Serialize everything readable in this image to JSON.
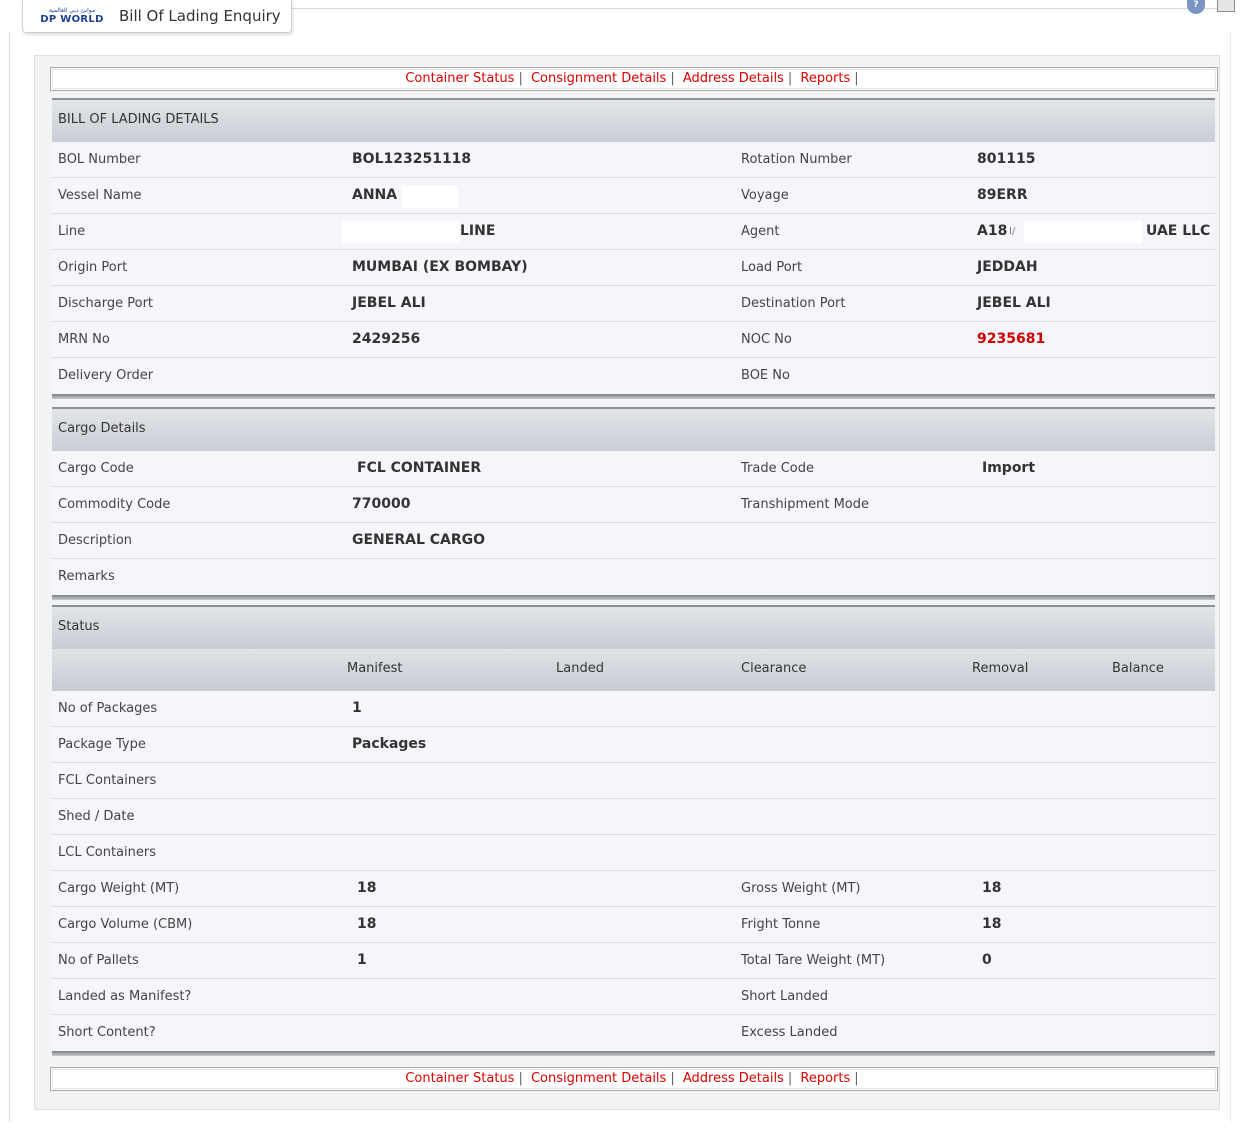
{
  "header": {
    "logo_arabic": "موانئ دبي العالمية",
    "logo_text": "DP WORLD",
    "tab_title": "Bill Of Lading Enquiry",
    "help_glyph": "?"
  },
  "links": [
    "Container Status",
    "Consignment Details",
    "Address Details",
    "Reports"
  ],
  "bol": {
    "title": "BILL OF LADING DETAILS",
    "rows": [
      {
        "l1": "BOL Number",
        "v1": "BOL123251118",
        "l2": "Rotation Number",
        "v2": "801115"
      },
      {
        "l1": "Vessel Name",
        "v1": "ANNA",
        "l2": "Voyage",
        "v2": "89ERR"
      },
      {
        "l1": "Line",
        "v1": "LINE",
        "l2": "Agent",
        "v2": "A18",
        "v2_mid": "I/",
        "v2_end": "UAE LLC"
      },
      {
        "l1": "Origin Port",
        "v1": "MUMBAI (EX BOMBAY)",
        "l2": "Load Port",
        "v2": "JEDDAH"
      },
      {
        "l1": "Discharge Port",
        "v1": "JEBEL ALI",
        "l2": "Destination Port",
        "v2": "JEBEL ALI"
      },
      {
        "l1": "MRN No",
        "v1": "2429256",
        "l2": "NOC No",
        "v2": "9235681"
      },
      {
        "l1": "Delivery Order",
        "v1": "",
        "l2": "BOE No",
        "v2": ""
      }
    ]
  },
  "cargo": {
    "title": "Cargo Details",
    "rows": [
      {
        "l1": "Cargo Code",
        "v1": "FCL CONTAINER",
        "l2": "Trade Code",
        "v2": "Import"
      },
      {
        "l1": "Commodity Code",
        "v1": "770000",
        "l2": "Transhipment Mode",
        "v2": ""
      },
      {
        "l1": "Description",
        "v1": "GENERAL CARGO",
        "l2": "",
        "v2": ""
      },
      {
        "l1": "Remarks",
        "v1": "",
        "l2": "",
        "v2": ""
      }
    ]
  },
  "status": {
    "title": "Status",
    "columns": [
      "Manifest",
      "Landed",
      "Clearance",
      "Removal",
      "Balance"
    ],
    "rows": [
      {
        "l1": "No of Packages",
        "v1": "1",
        "l2": "",
        "v2": ""
      },
      {
        "l1": "Package Type",
        "v1": "Packages",
        "l2": "",
        "v2": ""
      },
      {
        "l1": "FCL Containers",
        "v1": "",
        "l2": "",
        "v2": ""
      },
      {
        "l1": "Shed / Date",
        "v1": "",
        "l2": "",
        "v2": ""
      },
      {
        "l1": "LCL Containers",
        "v1": "",
        "l2": "",
        "v2": ""
      },
      {
        "l1": "Cargo Weight (MT)",
        "v1": "18",
        "l2": "Gross Weight (MT)",
        "v2": "18"
      },
      {
        "l1": "Cargo Volume (CBM)",
        "v1": "18",
        "l2": "Fright Tonne",
        "v2": "18"
      },
      {
        "l1": "No of Pallets",
        "v1": "1",
        "l2": "Total Tare Weight (MT)",
        "v2": "0"
      },
      {
        "l1": "Landed as Manifest?",
        "v1": "",
        "l2": "Short Landed",
        "v2": ""
      },
      {
        "l1": "Short Content?",
        "v1": "",
        "l2": "Excess Landed",
        "v2": ""
      }
    ]
  },
  "colors": {
    "link": "#dd0000",
    "noc_value": "#d00000",
    "header_gradient_top": "#e2e4e8",
    "header_gradient_bottom": "#c9cdd5"
  }
}
